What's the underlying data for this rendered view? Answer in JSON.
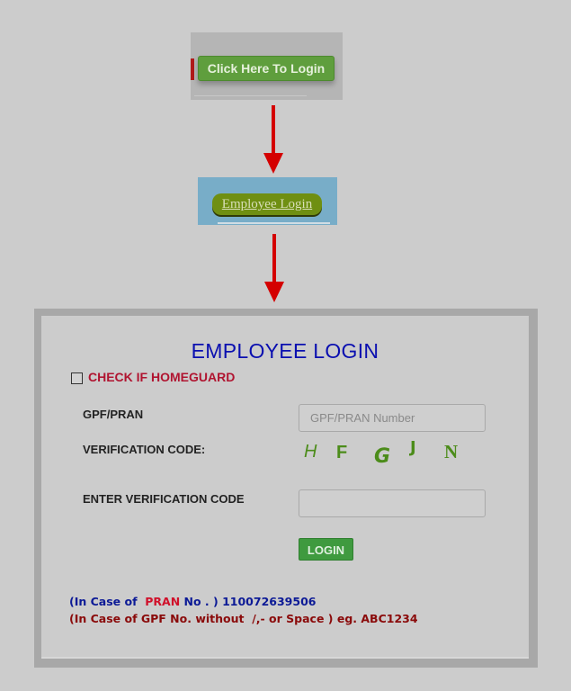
{
  "step1": {
    "button_label": "Click Here To Login"
  },
  "step2": {
    "button_label": "Employee Login"
  },
  "arrows": [
    {
      "icon": "arrow-down-icon",
      "color": "#d40000"
    },
    {
      "icon": "arrow-down-icon",
      "color": "#d40000"
    }
  ],
  "login_form": {
    "title": "EMPLOYEE LOGIN",
    "homeguard_label": "CHECK IF HOMEGUARD",
    "homeguard_checked": false,
    "gpf_label": "GPF/PRAN",
    "gpf_placeholder": "GPF/PRAN Number",
    "gpf_value": "",
    "verification_label": "VERIFICATION CODE:",
    "captcha_chars": [
      "H",
      "F",
      "G",
      "J",
      "N"
    ],
    "enter_code_label": "ENTER VERIFICATION CODE",
    "enter_code_value": "",
    "login_button": "LOGIN"
  },
  "notes": {
    "pran_prefix": "(In Case of  ",
    "pran_word": "PRAN",
    "pran_suffix": " No . ) 110072639506",
    "gpf_line": "(In Case of GPF No. without  /,- or Space ) eg. ABC1234"
  },
  "colors": {
    "background": "#cccccc",
    "title_blue": "#0a0fb0",
    "homeguard_red": "#b01430",
    "captcha_green": "#4c8c1a",
    "login_green": "#3f9a3f",
    "arrow_red": "#d40000"
  }
}
